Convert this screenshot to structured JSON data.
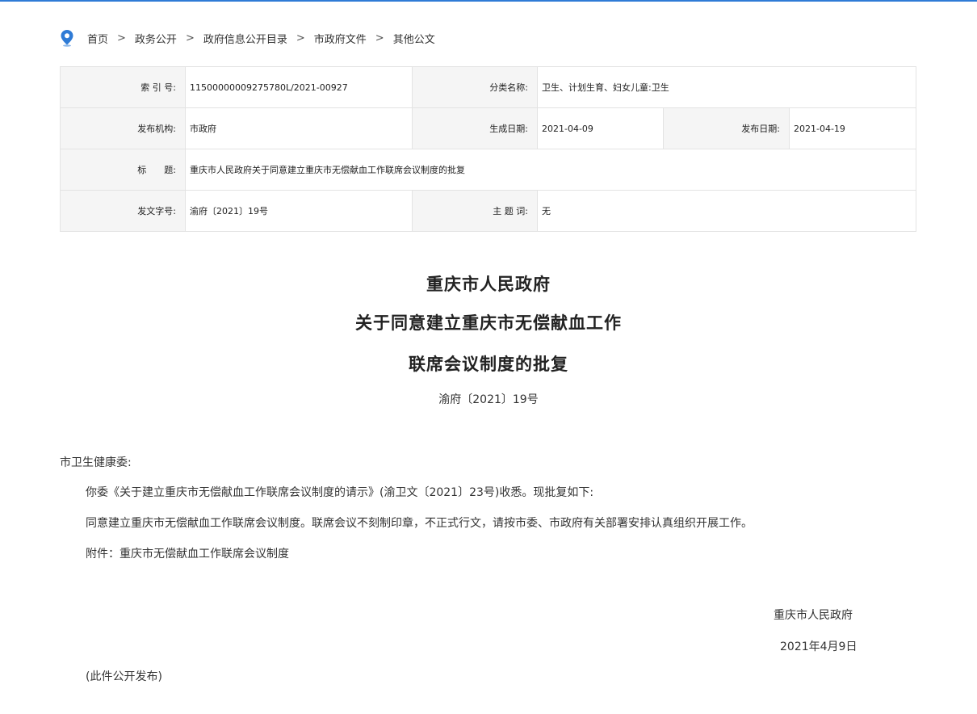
{
  "breadcrumb": {
    "items": [
      "首页",
      "政务公开",
      "政府信息公开目录",
      "市政府文件",
      "其他公文"
    ],
    "separator": ">"
  },
  "meta": {
    "index_label": "索 引 号:",
    "index_value": "11500000009275780L/2021-00927",
    "category_label": "分类名称:",
    "category_value": "卫生、计划生育、妇女儿童:卫生",
    "issuer_label": "发布机构:",
    "issuer_value": "市政府",
    "created_label": "生成日期:",
    "created_value": "2021-04-09",
    "published_label": "发布日期:",
    "published_value": "2021-04-19",
    "title_label": "标　　题:",
    "title_value": "重庆市人民政府关于同意建立重庆市无偿献血工作联席会议制度的批复",
    "docno_label": "发文字号:",
    "docno_value": "渝府〔2021〕19号",
    "keywords_label": "主 题 词:",
    "keywords_value": "无"
  },
  "document": {
    "title_line1": "重庆市人民政府",
    "title_line2": "关于同意建立重庆市无偿献血工作",
    "title_line3": "联席会议制度的批复",
    "doc_number": "渝府〔2021〕19号",
    "salutation": "市卫生健康委:",
    "para1": "你委《关于建立重庆市无偿献血工作联席会议制度的请示》(渝卫文〔2021〕23号)收悉。现批复如下:",
    "para2": "同意建立重庆市无偿献血工作联席会议制度。联席会议不刻制印章，不正式行文，请按市委、市政府有关部署安排认真组织开展工作。",
    "attachment": "附件：重庆市无偿献血工作联席会议制度",
    "signature": "重庆市人民政府",
    "date": "2021年4月9日",
    "note": "(此件公开发布)"
  },
  "colors": {
    "accent": "#2f7bd6",
    "label_bg": "#f5f5f5",
    "border": "#e3e3e3"
  },
  "icons": {
    "breadcrumb": "location-pin-icon"
  }
}
